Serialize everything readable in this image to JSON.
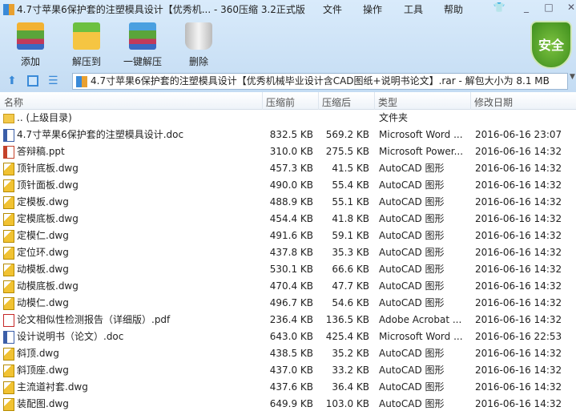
{
  "window": {
    "title": "4.7寸苹果6保护套的注塑模具设计【优秀机... - 360压缩 3.2正式版",
    "menu": [
      "文件",
      "操作",
      "工具",
      "帮助"
    ]
  },
  "toolbar": [
    {
      "label": "添加",
      "icon": "add-archive-icon"
    },
    {
      "label": "解压到",
      "icon": "extract-to-icon"
    },
    {
      "label": "一键解压",
      "icon": "one-click-extract-icon"
    },
    {
      "label": "删除",
      "icon": "trash-icon"
    }
  ],
  "security_badge": "安全",
  "address": "4.7寸苹果6保护套的注塑模具设计【优秀机械毕业设计含CAD图纸+说明书论文】.rar - 解包大小为 8.1 MB",
  "columns": [
    "名称",
    "压缩前",
    "压缩后",
    "类型",
    "修改日期"
  ],
  "files": [
    {
      "name": ".. (上级目录)",
      "size": "",
      "packed": "",
      "type": "文件夹",
      "date": "",
      "icon": "folder"
    },
    {
      "name": "4.7寸苹果6保护套的注塑模具设计.doc",
      "size": "832.5 KB",
      "packed": "569.2 KB",
      "type": "Microsoft Word ...",
      "date": "2016-06-16 23:07",
      "icon": "doc"
    },
    {
      "name": "答辩稿.ppt",
      "size": "310.0 KB",
      "packed": "275.5 KB",
      "type": "Microsoft Power...",
      "date": "2016-06-16 14:32",
      "icon": "ppt"
    },
    {
      "name": "顶针底板.dwg",
      "size": "457.3 KB",
      "packed": "41.5 KB",
      "type": "AutoCAD 图形",
      "date": "2016-06-16 14:32",
      "icon": "dwg"
    },
    {
      "name": "顶针面板.dwg",
      "size": "490.0 KB",
      "packed": "55.4 KB",
      "type": "AutoCAD 图形",
      "date": "2016-06-16 14:32",
      "icon": "dwg"
    },
    {
      "name": "定模板.dwg",
      "size": "488.9 KB",
      "packed": "55.1 KB",
      "type": "AutoCAD 图形",
      "date": "2016-06-16 14:32",
      "icon": "dwg"
    },
    {
      "name": "定模底板.dwg",
      "size": "454.4 KB",
      "packed": "41.8 KB",
      "type": "AutoCAD 图形",
      "date": "2016-06-16 14:32",
      "icon": "dwg"
    },
    {
      "name": "定模仁.dwg",
      "size": "491.6 KB",
      "packed": "59.1 KB",
      "type": "AutoCAD 图形",
      "date": "2016-06-16 14:32",
      "icon": "dwg"
    },
    {
      "name": "定位环.dwg",
      "size": "437.8 KB",
      "packed": "35.3 KB",
      "type": "AutoCAD 图形",
      "date": "2016-06-16 14:32",
      "icon": "dwg"
    },
    {
      "name": "动模板.dwg",
      "size": "530.1 KB",
      "packed": "66.6 KB",
      "type": "AutoCAD 图形",
      "date": "2016-06-16 14:32",
      "icon": "dwg"
    },
    {
      "name": "动模底板.dwg",
      "size": "470.4 KB",
      "packed": "47.7 KB",
      "type": "AutoCAD 图形",
      "date": "2016-06-16 14:32",
      "icon": "dwg"
    },
    {
      "name": "动模仁.dwg",
      "size": "496.7 KB",
      "packed": "54.6 KB",
      "type": "AutoCAD 图形",
      "date": "2016-06-16 14:32",
      "icon": "dwg"
    },
    {
      "name": "论文相似性检测报告（详细版）.pdf",
      "size": "236.4 KB",
      "packed": "136.5 KB",
      "type": "Adobe Acrobat ...",
      "date": "2016-06-16 14:32",
      "icon": "pdf"
    },
    {
      "name": "设计说明书（论文）.doc",
      "size": "643.0 KB",
      "packed": "425.4 KB",
      "type": "Microsoft Word ...",
      "date": "2016-06-16 22:53",
      "icon": "doc"
    },
    {
      "name": "斜顶.dwg",
      "size": "438.5 KB",
      "packed": "35.2 KB",
      "type": "AutoCAD 图形",
      "date": "2016-06-16 14:32",
      "icon": "dwg"
    },
    {
      "name": "斜顶座.dwg",
      "size": "437.0 KB",
      "packed": "33.2 KB",
      "type": "AutoCAD 图形",
      "date": "2016-06-16 14:32",
      "icon": "dwg"
    },
    {
      "name": "主流道衬套.dwg",
      "size": "437.6 KB",
      "packed": "36.4 KB",
      "type": "AutoCAD 图形",
      "date": "2016-06-16 14:32",
      "icon": "dwg"
    },
    {
      "name": "装配图.dwg",
      "size": "649.9 KB",
      "packed": "103.0 KB",
      "type": "AutoCAD 图形",
      "date": "2016-06-16 14:32",
      "icon": "dwg"
    }
  ]
}
